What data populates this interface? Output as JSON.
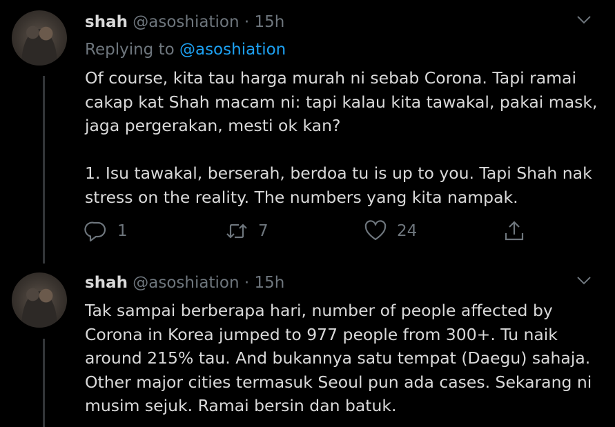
{
  "tweets": [
    {
      "name": "shah",
      "handle": "@asoshiation",
      "separator": "·",
      "time": "15h",
      "replying_prefix": "Replying to",
      "replying_to": "@asoshiation",
      "paragraphs": [
        [
          "Of course, kita tau harga murah ni sebab Corona. Tapi ramai",
          "cakap kat Shah macam ni: tapi kalau kita tawakal, pakai mask,",
          "jaga pergerakan, mesti ok kan?"
        ],
        [
          "1. Isu tawakal, berserah, berdoa tu is up to you. Tapi Shah nak",
          "stress on the reality. The numbers yang kita nampak."
        ]
      ],
      "reply_count": "1",
      "retweet_count": "7",
      "like_count": "24"
    },
    {
      "name": "shah",
      "handle": "@asoshiation",
      "separator": "·",
      "time": "15h",
      "paragraphs": [
        [
          "Tak sampai berberapa hari, number of people affected by",
          "Corona in Korea jumped to 977 people from 300+. Tu naik",
          "around 215% tau. And bukannya satu tempat (Daegu) sahaja.",
          "Other major cities termasuk Seoul pun ada cases. Sekarang ni",
          "musim sejuk. Ramai bersin dan batuk."
        ]
      ]
    }
  ],
  "icons": {
    "reply": "reply-icon",
    "retweet": "retweet-icon",
    "like": "heart-icon",
    "share": "share-icon",
    "more": "chevron-down-icon"
  },
  "colors": {
    "background": "#000000",
    "text": "#d9d9d9",
    "secondary": "#6e767d",
    "accent": "#1da1f2"
  }
}
